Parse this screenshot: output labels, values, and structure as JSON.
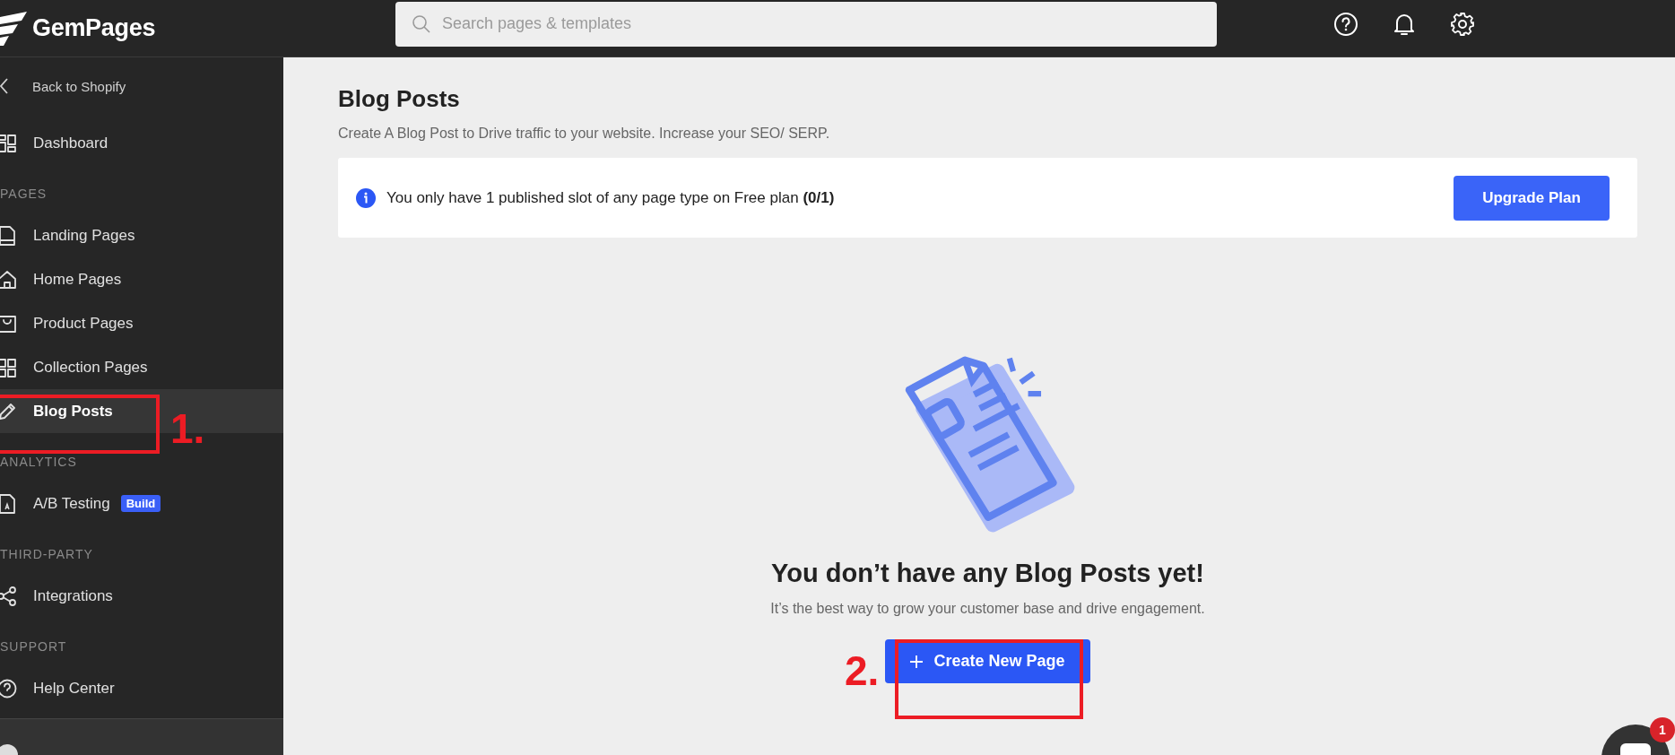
{
  "topbar": {
    "logo": "GemPages",
    "search": {
      "placeholder": "Search pages & templates"
    }
  },
  "sidebar": {
    "back_link": "Back to Shopify",
    "groups": [
      {
        "items": [
          {
            "label": "Dashboard",
            "selected": false
          }
        ]
      },
      {
        "heading": "PAGES",
        "items": [
          {
            "label": "Landing Pages",
            "selected": false
          },
          {
            "label": "Home Pages",
            "selected": false
          },
          {
            "label": "Product Pages",
            "selected": false
          },
          {
            "label": "Collection Pages",
            "selected": false
          },
          {
            "label": "Blog Posts",
            "selected": true
          }
        ]
      },
      {
        "heading": "ANALYTICS",
        "items": [
          {
            "label": "A/B Testing",
            "selected": false,
            "badge": "Build"
          }
        ]
      },
      {
        "heading": "THIRD-PARTY",
        "items": [
          {
            "label": "Integrations",
            "selected": false
          }
        ]
      },
      {
        "heading": "SUPPORT",
        "items": [
          {
            "label": "Help Center",
            "selected": false
          }
        ]
      }
    ]
  },
  "main": {
    "title": "Blog Posts",
    "subtitle": "Create A Blog Post to Drive traffic to your website. Increase your SEO/ SERP.",
    "notice": {
      "text": "You only have 1 published slot of any page type on Free plan **(0/1)**",
      "button": "Upgrade Plan"
    },
    "empty_state": {
      "heading": "You don’t have any Blog Posts yet!",
      "text": "It’s the best way to grow your customer base and drive engagement.",
      "button": "Create New Page"
    }
  },
  "annotations": [
    {
      "label": "1."
    },
    {
      "label": "2."
    }
  ],
  "chat": {
    "badge": "1"
  }
}
